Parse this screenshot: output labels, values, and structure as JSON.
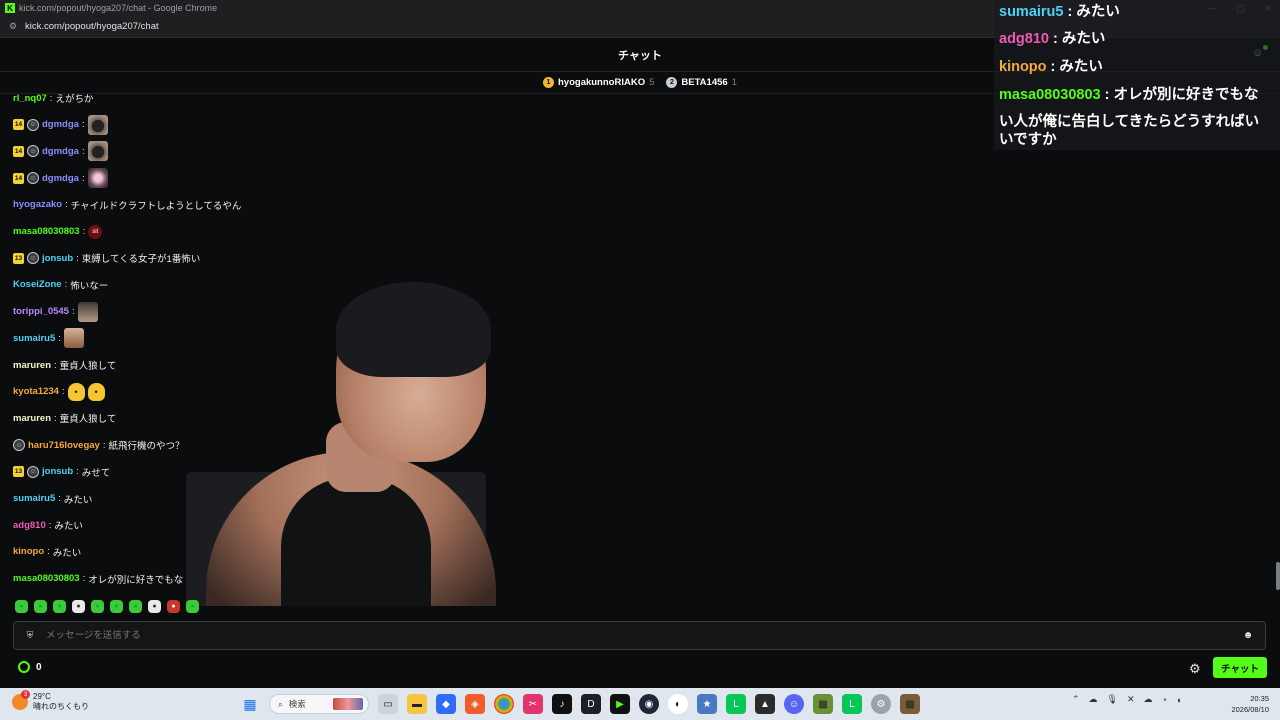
{
  "window": {
    "title": "kick.com/popout/hyoga207/chat - Google Chrome",
    "url": "kick.com/popout/hyoga207/chat"
  },
  "header": {
    "title": "チャット"
  },
  "top_gifters": [
    {
      "rank": "1",
      "name": "hyogakunnoRIAKO",
      "count": "5"
    },
    {
      "rank": "2",
      "name": "BETA1456",
      "count": "1"
    }
  ],
  "messages": [
    {
      "user": "rl_nq07",
      "color": "#53fc18",
      "text": "えがちか",
      "sub": "",
      "og": false,
      "emotes": []
    },
    {
      "user": "dgmdga",
      "color": "#8b8cff",
      "text": "",
      "sub": "14",
      "og": true,
      "emotes": [
        "bowl"
      ]
    },
    {
      "user": "dgmdga",
      "color": "#8b8cff",
      "text": "",
      "sub": "14",
      "og": true,
      "emotes": [
        "bowl"
      ]
    },
    {
      "user": "dgmdga",
      "color": "#8b8cff",
      "text": "",
      "sub": "14",
      "og": true,
      "emotes": [
        "star"
      ]
    },
    {
      "user": "hyogazako",
      "color": "#8b8cff",
      "text": "チャイルドクラフトしようとしてるやん",
      "sub": "",
      "og": false,
      "emotes": []
    },
    {
      "user": "masa08030803",
      "color": "#53fc18",
      "text": "",
      "sub": "",
      "og": false,
      "emotes": [
        "sit"
      ]
    },
    {
      "user": "jonsub",
      "color": "#4fd2f5",
      "text": "束縛してくる女子が1番怖い",
      "sub": "13",
      "og": true,
      "emotes": []
    },
    {
      "user": "KoseiZone",
      "color": "#4fd2f5",
      "text": "怖いなー",
      "sub": "",
      "og": false,
      "emotes": []
    },
    {
      "user": "torippi_0545",
      "color": "#b48bff",
      "text": "",
      "sub": "",
      "og": false,
      "emotes": [
        "face1"
      ]
    },
    {
      "user": "sumairu5",
      "color": "#4fd2f5",
      "text": "",
      "sub": "",
      "og": false,
      "emotes": [
        "face2"
      ]
    },
    {
      "user": "maruren",
      "color": "#f5f5c8",
      "text": "童貞人狼して",
      "sub": "",
      "og": false,
      "emotes": []
    },
    {
      "user": "kyota1234",
      "color": "#f4a93c",
      "text": "",
      "sub": "",
      "og": false,
      "emotes": [
        "duck",
        "duck"
      ]
    },
    {
      "user": "maruren",
      "color": "#f5f5c8",
      "text": "童貞人狼して",
      "sub": "",
      "og": false,
      "emotes": []
    },
    {
      "user": "haru716lovegay",
      "color": "#f4a93c",
      "text": "紙飛行機のやつ？",
      "sub": "",
      "og": true,
      "emotes": []
    },
    {
      "user": "jonsub",
      "color": "#4fd2f5",
      "text": "みせて",
      "sub": "13",
      "og": true,
      "emotes": []
    },
    {
      "user": "sumairu5",
      "color": "#4fd2f5",
      "text": "みたい",
      "sub": "",
      "og": false,
      "emotes": []
    },
    {
      "user": "adg810",
      "color": "#f05ab4",
      "text": "みたい",
      "sub": "",
      "og": false,
      "emotes": []
    },
    {
      "user": "kinopo",
      "color": "#f4a93c",
      "text": "みたい",
      "sub": "",
      "og": false,
      "emotes": []
    },
    {
      "user": "masa08030803",
      "color": "#53fc18",
      "text": "オレが別に好きでもな",
      "sub": "",
      "og": false,
      "emotes": []
    }
  ],
  "overlay": [
    {
      "user": "sumairu5",
      "color": "#4fd2f5",
      "text": " : みたい"
    },
    {
      "user": "adg810",
      "color": "#f05ab4",
      "text": " : みたい"
    },
    {
      "user": "kinopo",
      "color": "#f4a93c",
      "text": " : みたい"
    },
    {
      "user": "masa08030803",
      "color": "#53fc18",
      "text": " : オレが別に好きでもな"
    },
    {
      "user": "",
      "color": "#ffffff",
      "text": "い人が俺に告白してきたらどうすればい"
    },
    {
      "user": "",
      "color": "#ffffff",
      "text": "いですか"
    }
  ],
  "input": {
    "placeholder": "メッセージを送信する"
  },
  "points": {
    "value": "0"
  },
  "chat_button": "チャット",
  "taskbar": {
    "weather_temp": "29°C",
    "weather_desc": "晴れのちくもり",
    "weather_badge": "3",
    "search_placeholder": "検索",
    "time": "20:35",
    "date": "2026/08/10"
  }
}
